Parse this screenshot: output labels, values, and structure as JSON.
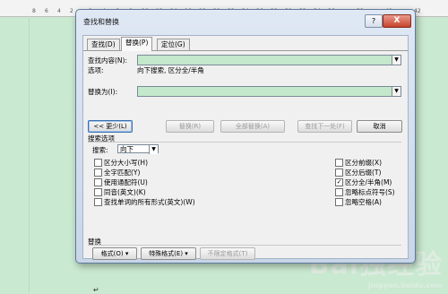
{
  "ruler": {
    "ticks": [
      "8",
      "6",
      "4",
      "2",
      "",
      "2",
      "4",
      "6",
      "8",
      "10",
      "12",
      "14",
      "16",
      "18",
      "20",
      "22",
      "24",
      "26",
      "28",
      "30",
      "32",
      "34",
      "36",
      "38",
      "40",
      "42"
    ]
  },
  "dialog": {
    "title": "查找和替换",
    "help_label": "?",
    "close_label": "X",
    "tabs": [
      {
        "label": "查找(D)",
        "active": false
      },
      {
        "label": "替换(P)",
        "active": true
      },
      {
        "label": "定位(G)",
        "active": false
      }
    ],
    "find": {
      "label": "查找内容(N):",
      "value": "",
      "options_label": "选项:",
      "options_value": "向下搜索, 区分全/半角"
    },
    "replace": {
      "label": "替换为(I):",
      "value": ""
    },
    "buttons": {
      "less": "<< 更少(L)",
      "replace": "替换(R)",
      "replace_all": "全部替换(A)",
      "find_next": "查找下一处(F)",
      "cancel": "取消"
    },
    "search_options": {
      "heading": "搜索选项",
      "search_label": "搜索:",
      "search_value": "向下",
      "left": [
        {
          "label": "区分大小写(H)",
          "checked": false
        },
        {
          "label": "全字匹配(Y)",
          "checked": false
        },
        {
          "label": "使用通配符(U)",
          "checked": false
        },
        {
          "label": "同音(英文)(K)",
          "checked": false
        },
        {
          "label": "查找单词的所有形式(英文)(W)",
          "checked": false
        }
      ],
      "right": [
        {
          "label": "区分前缀(X)",
          "checked": false
        },
        {
          "label": "区分后缀(T)",
          "checked": false
        },
        {
          "label": "区分全/半角(M)",
          "checked": true
        },
        {
          "label": "忽略标点符号(S)",
          "checked": false
        },
        {
          "label": "忽略空格(A)",
          "checked": false
        }
      ]
    },
    "replace_section": {
      "heading": "替换",
      "format_button": "格式(O) ▾",
      "special_button": "特殊格式(E) ▾",
      "no_format_button": "不限定格式(T)"
    }
  },
  "document": {
    "paragraph_mark": "↵"
  },
  "watermark": {
    "text": "Bai独经验",
    "sub": "jingyan.baidu.com"
  }
}
